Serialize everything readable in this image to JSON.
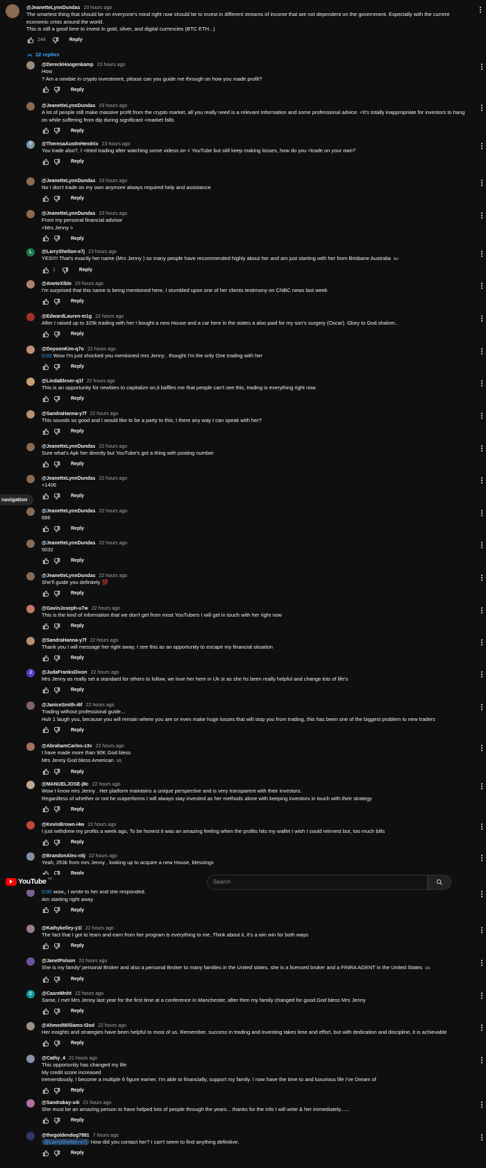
{
  "top_comment": {
    "author": "@JeanetteLynnDundas",
    "time": "23 hours ago",
    "lines": [
      "The smartest thing that should be on everyone's mind right now should be to invest in different streams of income that are not dependent on the government. Especially with the current",
      "economic crisis around the world.",
      "This is still a good time to invest in gold, silver, and digital currencies (BTC ETH...)"
    ],
    "likes": "244",
    "reply_label": "Reply",
    "replies_toggle": "32 replies"
  },
  "guide_tab": "navigation",
  "masthead": {
    "logo_text": "YouTube",
    "region": "NR",
    "search_placeholder": "Search"
  },
  "replies": [
    {
      "author": "@DereckHoogenkamp",
      "time": "23 hours ago",
      "color": "#9a8a7a",
      "initial": "",
      "lines": [
        "How",
        "?  Am a newbie in crypto investment, please can you guide me through on how you made profit?"
      ]
    },
    {
      "author": "@JeanetteLynnDundas",
      "time": "23 hours ago",
      "color": "#8a6a52",
      "initial": "",
      "lines": [
        "A lot of people still make massive profit from the crypto market, all you really need is a relevant information and some professional advice. <It's totally inappropriate for investors to hang",
        "on while suffering from dip during significant <market falls"
      ]
    },
    {
      "author": "@TheresaAustinHendrix",
      "time": "23 hours ago",
      "color": "#7a9aa8",
      "initial": "T",
      "lines": [
        "You trade also?, I <tried trading after watching some videos on < YouTube but still keep making losses, how do you <trade on your own?"
      ]
    },
    {
      "author": "@JeanetteLynnDundas",
      "time": "23 hours ago",
      "color": "#8a6a52",
      "initial": "",
      "lines": [
        "No I don't trade on my own anymore always required help and assistance"
      ]
    },
    {
      "author": "@JeanetteLynnDundas",
      "time": "23 hours ago",
      "color": "#8a6a52",
      "initial": "",
      "lines": [
        "From my personal financial advisor",
        "<Mrs Jenny >"
      ]
    },
    {
      "author": "@LarryShelton-e7j",
      "time": "23 hours ago",
      "color": "#1e7a4e",
      "initial": "L",
      "lines": [
        "YES!!!! That's exactly her name (Mrs Jenny ) so many people have recommended highly about her and am just starting with her from Brisbane Australia"
      ],
      "flag": "AU",
      "likes": "1"
    },
    {
      "author": "@AneteXible",
      "time": "23 hours ago",
      "color": "#b08070",
      "initial": "",
      "lines": [
        "I'm surprised that this name is being mentioned here, I stumbled upon one of her clients testimony on CNBC news last week"
      ]
    },
    {
      "author": "@EdwardLauren-m1g",
      "time": "22 hours ago",
      "color": "#a03028",
      "initial": "",
      "lines": [
        "After I raised up to 325k trading with her I bought a new House and a car here in the states a also paid for my son's surgery (Oscar). Glory to God.shalom.."
      ]
    },
    {
      "author": "@DoyoonKim-q7o",
      "time": "22 hours ago",
      "color": "#c09078",
      "initial": "",
      "timestamp": "0:02",
      "lines": [
        "Wow I'm just shocked you mentioned mrs Jenny , thought I'm the only One trading with her"
      ]
    },
    {
      "author": "@LindaBleser-q1f",
      "time": "22 hours ago",
      "color": "#c8a070",
      "initial": "",
      "lines": [
        "This is an opportunity for newbies to capitalize on,it baffles me that people can't see this, trading is everything right now"
      ]
    },
    {
      "author": "@SandraHanna-y7f",
      "time": "22 hours ago",
      "color": "#b89070",
      "initial": "",
      "lines": [
        "This sounds so good and I would like to be a party to this, I there any way I can speak with her?"
      ]
    },
    {
      "author": "@JeanetteLynnDundas",
      "time": "22 hours ago",
      "color": "#8a6a52",
      "initial": "",
      "lines": [
        "Sure what's Apk her directly but YouTube's got a thing with posting number"
      ]
    },
    {
      "author": "@JeanetteLynnDundas",
      "time": "22 hours ago",
      "color": "#8a6a52",
      "initial": "",
      "lines": [
        "+1406"
      ]
    },
    {
      "author": "@JeanetteLynnDundas",
      "time": "22 hours ago",
      "color": "#8a6a52",
      "initial": "",
      "lines": [
        "686"
      ]
    },
    {
      "author": "@JeanetteLynnDundas",
      "time": "22 hours ago",
      "color": "#8a6a52",
      "initial": "",
      "lines": [
        "5032"
      ]
    },
    {
      "author": "@JeanetteLynnDundas",
      "time": "22 hours ago",
      "color": "#8a6a52",
      "initial": "",
      "lines": [
        "She'll guide you definitely 💯"
      ]
    },
    {
      "author": "@GavinJoseph-u7w",
      "time": "22 hours ago",
      "color": "#c07868",
      "initial": "",
      "lines": [
        "This is the kind of information that we don't get from most YouTubers I will get in touch with her right now"
      ]
    },
    {
      "author": "@SandraHanna-y7f",
      "time": "22 hours ago",
      "color": "#b89070",
      "initial": "",
      "lines": [
        "Thank you I will message her right away, I see this as an opportunity to escape my financial situation"
      ]
    },
    {
      "author": "@JudaFranksDixon",
      "time": "22 hours ago",
      "color": "#5b3fc4",
      "initial": "J",
      "lines": [
        "Mrs Jenny as really set a standard for others to follow, we love her here in Uk st as she hs been really helpful and change lots of life's"
      ]
    },
    {
      "author": "@JaniceSmith-i6f",
      "time": "22 hours ago",
      "color": "#806070",
      "initial": "",
      "lines": [
        "Trading without professional guide...",
        "Huh 1 laugh you, because you will remain where you are or even make huge losses that will stop you from trading, this has been one of the biggest problem to new traders"
      ]
    },
    {
      "author": "@AbrahamCarlos-z3v",
      "time": "22 hours ago",
      "color": "#a87060",
      "initial": "",
      "lines": [
        "I have made more than 90K God bless",
        "Mrs Jenny God bless American"
      ],
      "flag": "US"
    },
    {
      "author": "@MANUELJOSE-j8c",
      "time": "22 hours ago",
      "color": "#c0a890",
      "initial": "",
      "lines": [
        "Wow I know mrs Jenny . Her platform maintains a unique perspective and is very transparent with their investors.",
        "Regardless of whether or not he outperforms I will always stay invested as her methods alone with keeping investors in touch with their strategy"
      ]
    },
    {
      "author": "@KevinBrown-i4w",
      "time": "22 hours ago",
      "color": "#c04838",
      "initial": "",
      "lines": [
        "I just withdrew my profits a week ago, To be honest it was an amazing feeling when the profits hits my wallet I wish I could reinvest but, too much bills"
      ]
    },
    {
      "author": "@BrandonAlex-n5j",
      "time": "22 hours ago",
      "color": "#8090a0",
      "initial": "",
      "lines": [
        "Yeah, 253k from mrs Jenny , looking up to acquire a new House, blessings"
      ]
    },
    {
      "author": "",
      "time": "",
      "color": "#7a6090",
      "initial": "",
      "timestamp": "0:00",
      "lines": [
        "wow,, I wrote to her and she responded.",
        "Am starting right away"
      ]
    },
    {
      "author": "@Kathykelley-y1l",
      "time": "22 hours ago",
      "color": "#9a7a90",
      "initial": "",
      "lines": [
        "The fact that I got to learn and earn from her program is everything to me, Think about it, it's a win win for both ways"
      ]
    },
    {
      "author": "@JanetPolson",
      "time": "22 hours ago",
      "color": "#7050a0",
      "initial": "",
      "lines": [
        "She is my family' personal Broker and also a personal Broker to many families in the United states, she is a licensed broker and a FINRA AGENT in the United States"
      ],
      "flag": "US"
    },
    {
      "author": "@CasreMnht",
      "time": "22 hours ago",
      "color": "#10989a",
      "initial": "C",
      "lines": [
        "Same, I met Mrs Jenny  last year for the first time at a conference in Manchester, after then my family changed for good.God bless Mrs Jenny"
      ]
    },
    {
      "author": "@AhmedWilliams-t3od",
      "time": "22 hours ago",
      "color": "#a09080",
      "initial": "",
      "lines": [
        "Her insights and strategies have been helpful to most of us. Remember, success in trading and investing takes time and effort, but with dedication and discipline, it is achievable"
      ]
    },
    {
      "author": "@Cathy_4",
      "time": "21 hours ago",
      "color": "#8890a8",
      "initial": "",
      "lines": [
        "This opportunity has changed my life",
        "My credit score increased",
        "tremendously, I become a multiple 6 figure earner, I'm able to financially, support my family. I now have the time to and luxurious life I've Dream of"
      ]
    },
    {
      "author": "@Sandrakay-s4i",
      "time": "21 hours ago",
      "color": "#b070a0",
      "initial": "",
      "lines": [
        "She must be an amazing person to have helped lots of people through the years... thanks for the info I will write & her immediately......"
      ]
    },
    {
      "author": "@thegoldendog7991",
      "time": "7 hours ago",
      "color": "#303868",
      "initial": "",
      "mention": "@LarryShelton-e7j",
      "lines": [
        "How did you contact her? I can't seem to find anything definitive."
      ]
    }
  ],
  "reply_label": "Reply"
}
